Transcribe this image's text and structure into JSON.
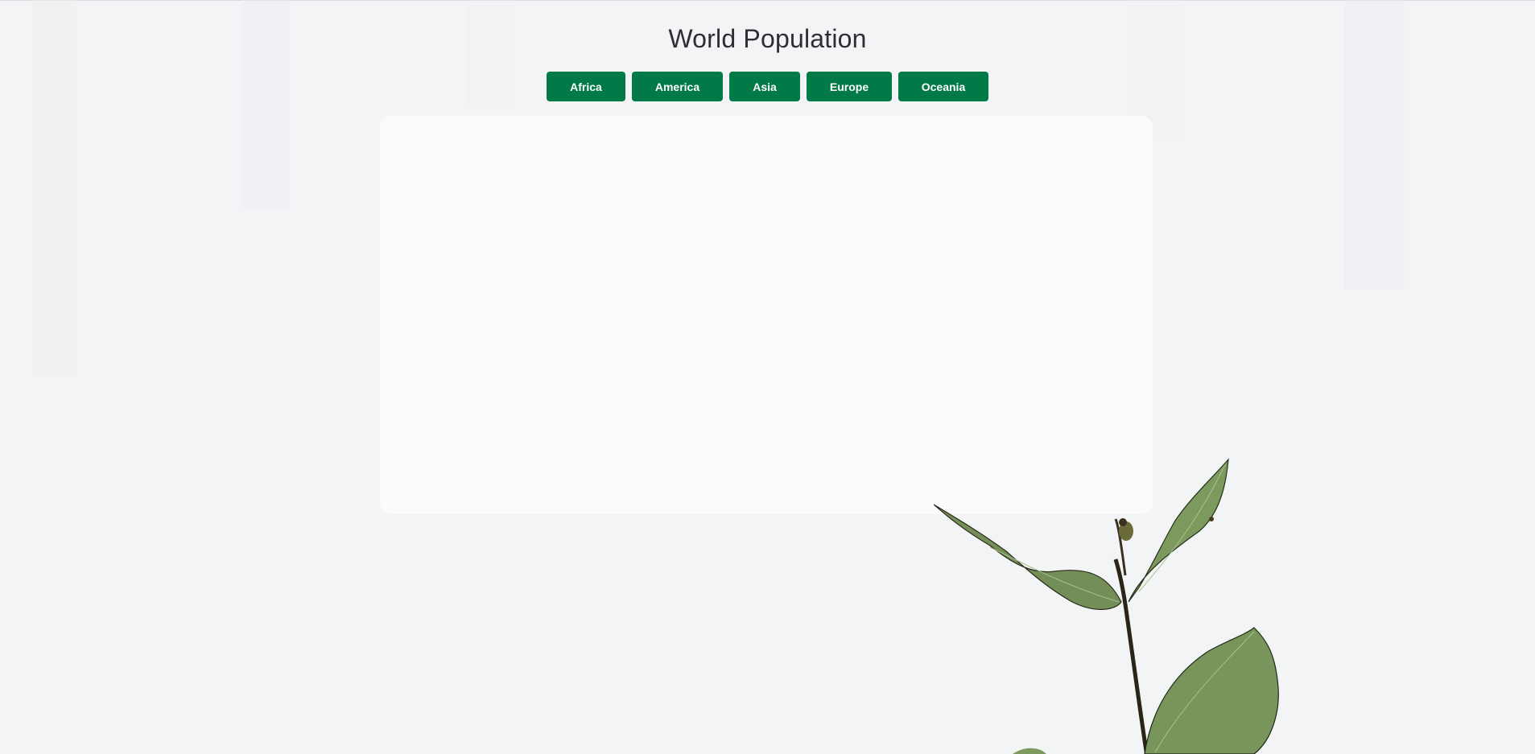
{
  "page": {
    "title": "World Population"
  },
  "regions": [
    {
      "label": "Africa"
    },
    {
      "label": "America"
    },
    {
      "label": "Asia"
    },
    {
      "label": "Europe"
    },
    {
      "label": "Oceania"
    }
  ],
  "colors": {
    "background": "#f3f4f6",
    "button": "#017a47",
    "button_text": "#ffffff",
    "card": "#fbfbfc",
    "title_text": "#2d2f33",
    "leaf": "#6f8f55",
    "stem": "#2b2418"
  },
  "icons": {
    "decoration": "plant-image"
  }
}
